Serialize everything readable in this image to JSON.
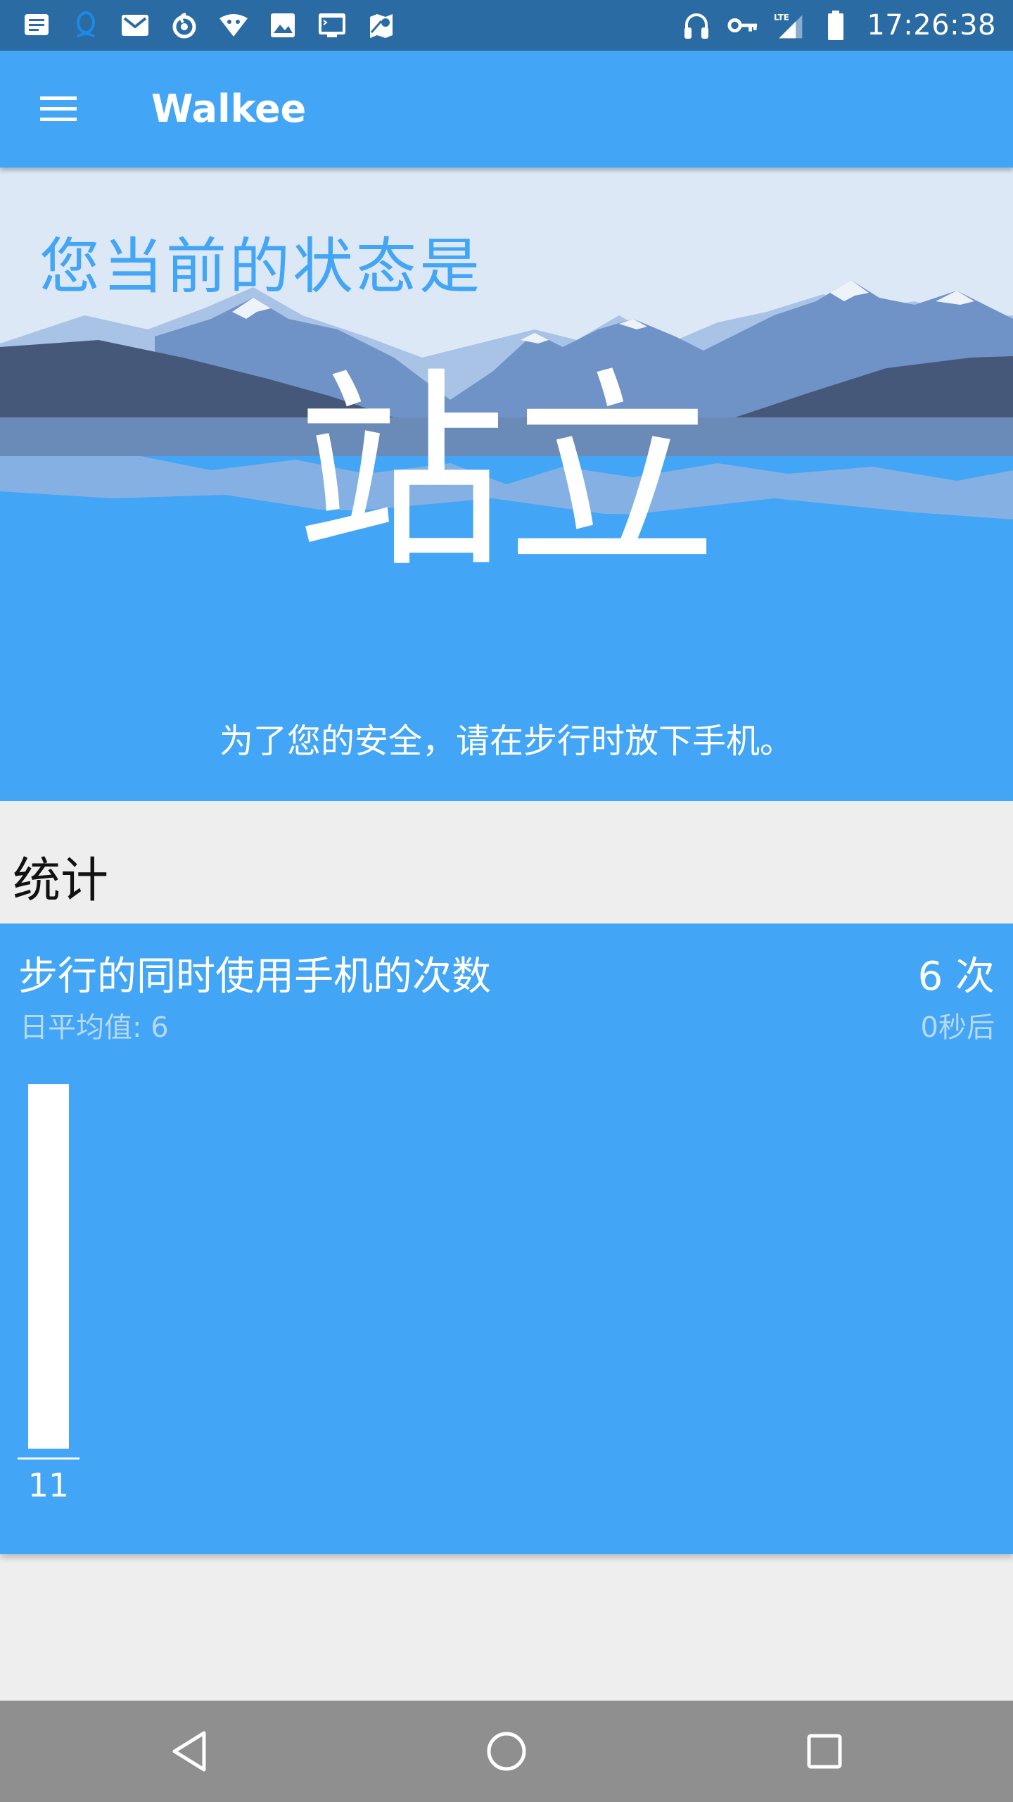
{
  "status_bar": {
    "left_icons": [
      "notification-icon",
      "qq-icon",
      "gmail-icon",
      "netease-music-icon",
      "vpn-robot-icon",
      "image-icon",
      "terminal-icon",
      "maps-icon"
    ],
    "right_icons": [
      "headphones-icon",
      "key-icon",
      "lte-signal-icon",
      "battery-icon"
    ],
    "network": "LTE",
    "time": "17:26:38"
  },
  "app_bar": {
    "title": "Walkee"
  },
  "hero": {
    "heading": "您当前的状态是",
    "status": "站立",
    "safety_tip": "为了您的安全，请在步行时放下手机。"
  },
  "stats": {
    "section_title": "统计",
    "card": {
      "title": "步行的同时使用手机的次数",
      "daily_average": "日平均值: 6",
      "count": "6 次",
      "time_ago": "0秒后"
    }
  },
  "chart_data": {
    "type": "bar",
    "categories": [
      "11"
    ],
    "values": [
      6
    ],
    "title": "",
    "xlabel": "",
    "ylabel": "",
    "ylim": [
      0,
      6
    ],
    "bar_color": "#ffffff"
  },
  "colors": {
    "status_bar": "#2a6ba3",
    "primary": "#42a5f5",
    "background": "#eeeeee",
    "nav_bar": "#8f8f8f"
  },
  "nav_bar": {
    "icons": [
      "back-icon",
      "home-icon",
      "recents-icon"
    ]
  }
}
